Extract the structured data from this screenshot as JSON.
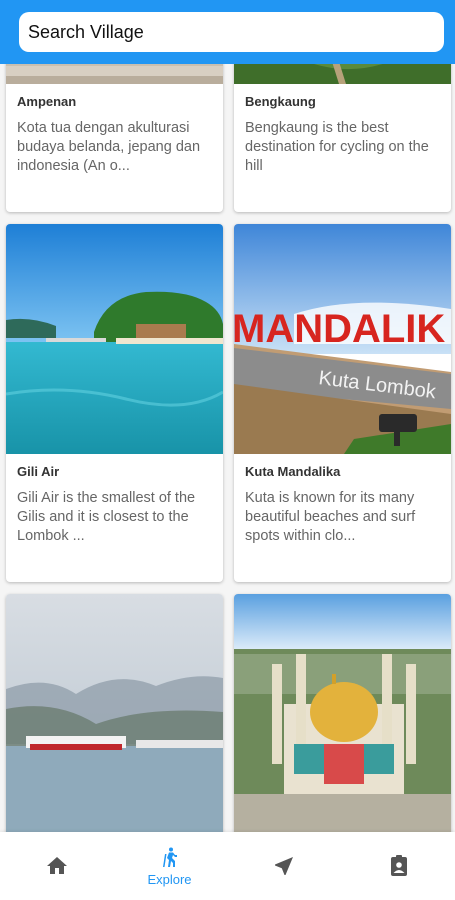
{
  "search": {
    "placeholder": "Search Village"
  },
  "cards": [
    {
      "title": "Ampenan",
      "description": "Kota tua dengan akulturasi budaya belanda, jepang dan indonesia (An o..."
    },
    {
      "title": "Bengkaung",
      "description": "Bengkaung is the best destination for cycling on the hill"
    },
    {
      "title": "Gili Air",
      "description": "Gili Air is the smallest of the Gilis and it is closest to the Lombok ..."
    },
    {
      "title": "Kuta Mandalika",
      "description": "Kuta is known for its many beautiful beaches and surf spots within clo..."
    }
  ],
  "images": {
    "mandalika_sign": "MANDALIK",
    "kuta_sign": "Kuta Lombok"
  },
  "bottom_nav": {
    "items": [
      {
        "icon": "home-icon",
        "label": ""
      },
      {
        "icon": "hiking-icon",
        "label": "Explore",
        "active": true
      },
      {
        "icon": "navigation-icon",
        "label": ""
      },
      {
        "icon": "contact-icon",
        "label": ""
      }
    ]
  },
  "colors": {
    "accent": "#2196f3",
    "inactive_icon": "#555555"
  }
}
